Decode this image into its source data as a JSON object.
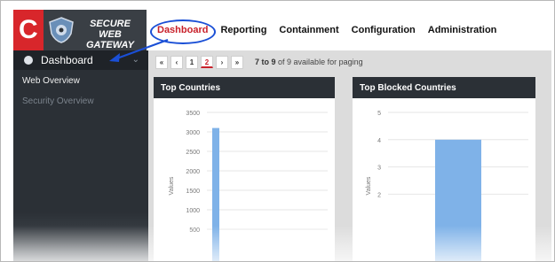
{
  "brand": {
    "line1": "SECURE WEB",
    "line2": "GATEWAY",
    "logo_letter": "C"
  },
  "topnav": [
    {
      "label": "Dashboard",
      "active": true
    },
    {
      "label": "Reporting"
    },
    {
      "label": "Containment"
    },
    {
      "label": "Configuration"
    },
    {
      "label": "Administration"
    }
  ],
  "sidebar": {
    "header": "Dashboard",
    "items": [
      {
        "label": "Web Overview"
      },
      {
        "label": "Security Overview"
      }
    ]
  },
  "pager": {
    "buttons": [
      "«",
      "‹",
      "1",
      "2",
      "›",
      "»"
    ],
    "current": "2",
    "info_range": "7 to 9",
    "info_rest": "of 9 available for paging"
  },
  "colors": {
    "accent": "#c8202a",
    "dark": "#2b3036",
    "highlight": "#1a4fd6",
    "bar": "#7fb2e8"
  },
  "chart_data": [
    {
      "type": "bar",
      "title": "Top Countries",
      "ylabel": "Values",
      "yticks": [
        500,
        1000,
        1500,
        2000,
        2500,
        3000,
        3500
      ],
      "ylim": [
        0,
        3500
      ],
      "categories": [
        ""
      ],
      "values": [
        3100
      ],
      "grid": true
    },
    {
      "type": "bar",
      "title": "Top Blocked Countries",
      "ylabel": "Values",
      "yticks": [
        2,
        3,
        4,
        5
      ],
      "ylim": [
        0,
        5
      ],
      "categories": [
        ""
      ],
      "values": [
        4
      ],
      "grid": true
    }
  ]
}
